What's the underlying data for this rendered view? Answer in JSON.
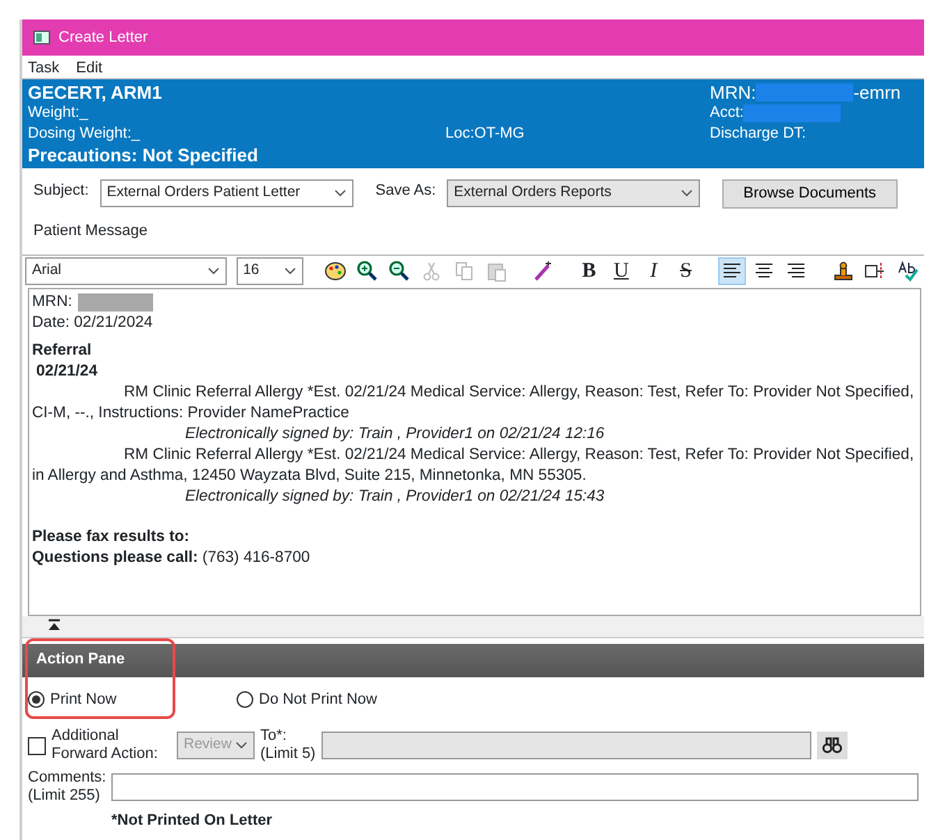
{
  "window": {
    "title": "Create Letter"
  },
  "menu": [
    "Task",
    "Edit"
  ],
  "patient": {
    "name": "GECERT, ARM1",
    "weight": "Weight:_",
    "dosing_weight": "Dosing Weight:_",
    "location": "Loc:OT-MG",
    "precautions": "Precautions: Not Specified",
    "mrn_label": "MRN:",
    "mrn_suffix": "-emrn",
    "acct_label": "Acct:",
    "discharge": "Discharge DT:"
  },
  "form": {
    "subject_label": "Subject:",
    "subject": "External Orders Patient Letter",
    "save_as_label": "Save As:",
    "save_as": "External Orders Reports",
    "browse_button": "Browse Documents",
    "message_label": "Patient Message"
  },
  "toolbar": {
    "font": "Arial",
    "size": "16",
    "tools": [
      {
        "kind": "palette",
        "disabled": false,
        "selected": false
      },
      {
        "kind": "zoom-in",
        "disabled": false,
        "selected": false
      },
      {
        "kind": "zoom-out",
        "disabled": false,
        "selected": false
      },
      {
        "kind": "cut",
        "disabled": true,
        "selected": false
      },
      {
        "kind": "copy",
        "disabled": true,
        "selected": false
      },
      {
        "kind": "paste",
        "disabled": true,
        "selected": false
      },
      {
        "kind": "wand",
        "disabled": false,
        "selected": false
      },
      {
        "kind": "bold",
        "label": "B",
        "disabled": false,
        "selected": false
      },
      {
        "kind": "underline",
        "label": "U",
        "disabled": false,
        "selected": false
      },
      {
        "kind": "italic",
        "label": "I",
        "disabled": false,
        "selected": false
      },
      {
        "kind": "strike",
        "label": "S",
        "disabled": false,
        "selected": false
      },
      {
        "kind": "align-left",
        "disabled": false,
        "selected": true
      },
      {
        "kind": "align-center",
        "disabled": false,
        "selected": false
      },
      {
        "kind": "align-right",
        "disabled": false,
        "selected": false
      },
      {
        "kind": "stamp",
        "disabled": false,
        "selected": false
      },
      {
        "kind": "insert",
        "disabled": false,
        "selected": false
      },
      {
        "kind": "spell",
        "disabled": false,
        "selected": false
      }
    ]
  },
  "letter": [
    {
      "kind": "redacted",
      "text": "MRN:"
    },
    {
      "kind": "plain",
      "text": "Date: 02/21/2024"
    },
    {
      "kind": "heading",
      "text": "Referral"
    },
    {
      "kind": "date",
      "text": "02/21/24"
    },
    {
      "kind": "indent",
      "text": "RM Clinic Referral Allergy *Est. 02/21/24 Medical Service: Allergy, Reason: Test, Refer To: Provider Not Specified,"
    },
    {
      "kind": "plain",
      "text": "CI-M, --., Instructions: Provider NamePractice"
    },
    {
      "kind": "signature",
      "text": "Electronically signed by: Train , Provider1 on 02/21/24 12:16"
    },
    {
      "kind": "indent",
      "text": "RM Clinic Referral Allergy *Est. 02/21/24 Medical Service: Allergy, Reason: Test, Refer To: Provider Not Specified,"
    },
    {
      "kind": "plain",
      "text": "in Allergy and Asthma, 12450 Wayzata Blvd, Suite 215, Minnetonka, MN 55305."
    },
    {
      "kind": "signature",
      "text": "Electronically signed by: Train , Provider1 on 02/21/24 15:43"
    },
    {
      "kind": "heading-gap",
      "text": "Please fax results to:"
    },
    {
      "kind": "plain",
      "text": "**Questions please call:** (763) 416-8700"
    }
  ],
  "action_pane": {
    "title": "Action Pane",
    "highlighted": true,
    "print_options": [
      {
        "label": "Print Now",
        "selected": true
      },
      {
        "label": "Do Not Print Now",
        "selected": false
      }
    ],
    "forward": {
      "checked": false,
      "label": "Additional Forward Action:",
      "action": "Review",
      "to_label": "To*:",
      "to_limit": "(Limit 5)"
    },
    "comments_label": "Comments:",
    "comments_limit": "(Limit 255)",
    "note": "*Not Printed On Letter"
  }
}
